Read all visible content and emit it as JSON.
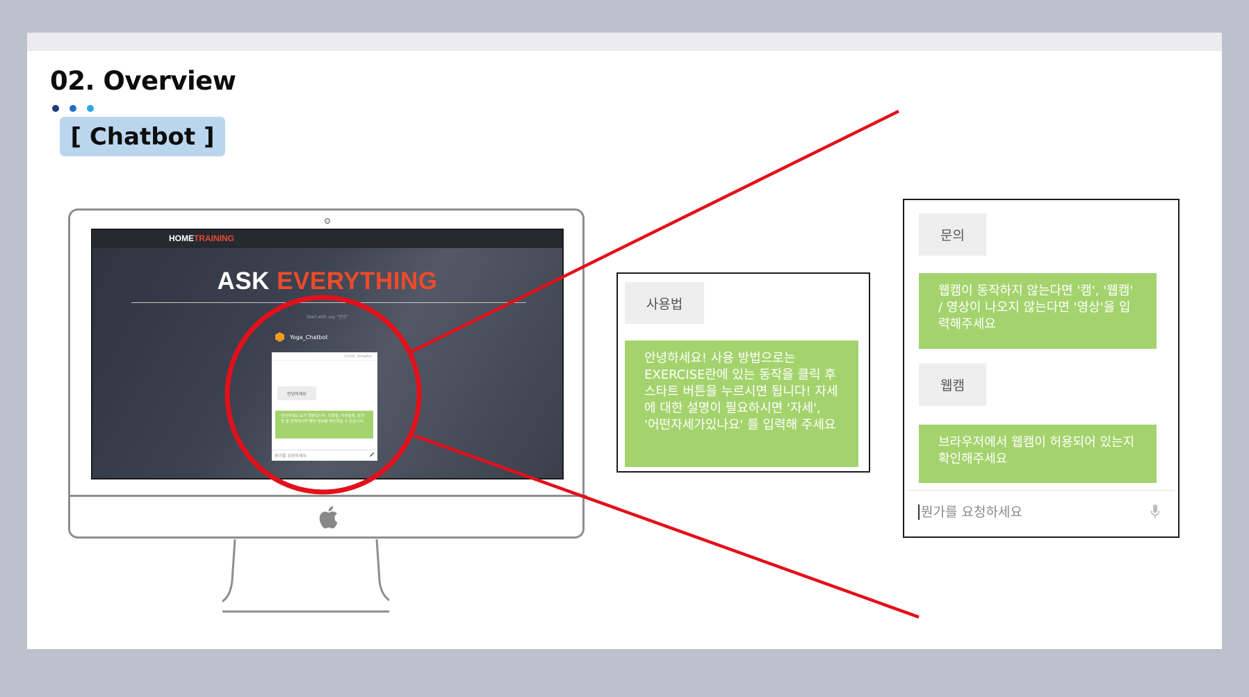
{
  "slide": {
    "title": "02. Overview",
    "tag": "[ Chatbot ]"
  },
  "screen": {
    "brand_home": "HOME",
    "brand_training": "TRAINING",
    "hero_ask": "ASK",
    "hero_everything": "EVERYTHING",
    "start_hint": "Start with say \"안녕\"",
    "bot_name": "Yoga_Chatbot",
    "mini_top": "유의사항 · Dialogflow",
    "mini_button": "안녕하세요",
    "mini_message": "안녕하세요 요가 챗봇입니다. 이용법, 자세설명, 문의 등 을 입력하시면 해당 정보를 확인하실 수 있습니다.",
    "mini_input": "뭔가를 요청하세요"
  },
  "panel1": {
    "question": "사용법",
    "answer": "안녕하세요! 사용 방법으로는 EXERCISE란에 있는 동작을 클릭 후 스타트 버튼을 누르시면 됩니다! 자세에 대한 설명이 필요하시면 '자세', '어떤자세가있나요' 를 입력해 주세요"
  },
  "panel2": {
    "question1": "문의",
    "answer1": "웹캠이 동작하지 않는다면 '캠', '웹캠' / 영상이 나오지 않는다면 '영상'을 입력해주세요",
    "question2": "웹캠",
    "answer2": "브라우저에서 웹캠이 허용되어 있는지 확인해주세요",
    "input_placeholder": "뭔가를 요청하세요"
  },
  "colors": {
    "accent_red": "#e3101a",
    "answer_green": "#a4d36e",
    "tag_blue": "#bad6ef"
  }
}
